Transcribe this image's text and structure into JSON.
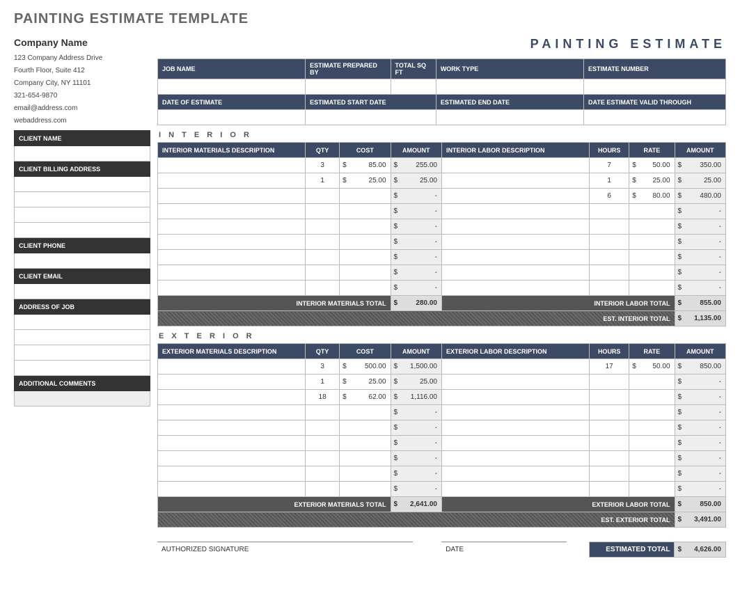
{
  "doc_title": "PAINTING ESTIMATE TEMPLATE",
  "estimate_heading": "PAINTING  ESTIMATE",
  "company": {
    "name": "Company Name",
    "addr1": "123 Company Address Drive",
    "addr2": "Fourth Floor, Suite 412",
    "addr3": "Company City, NY  11101",
    "phone": "321-654-9870",
    "email": "email@address.com",
    "web": "webaddress.com"
  },
  "job_header": {
    "labels": {
      "job_name": "JOB NAME",
      "prepared_by": "ESTIMATE PREPARED BY",
      "total_sqft": "TOTAL SQ FT",
      "work_type": "WORK TYPE",
      "estimate_number": "ESTIMATE NUMBER",
      "date_of_estimate": "DATE OF ESTIMATE",
      "est_start": "ESTIMATED START DATE",
      "est_end": "ESTIMATED END DATE",
      "valid_through": "DATE ESTIMATE VALID THROUGH"
    }
  },
  "client_labels": {
    "name": "CLIENT NAME",
    "billing": "CLIENT BILLING ADDRESS",
    "phone": "CLIENT PHONE",
    "email": "CLIENT EMAIL",
    "job_addr": "ADDRESS OF JOB",
    "comments": "ADDITIONAL COMMENTS"
  },
  "interior": {
    "title": "I N T E R I O R",
    "mat_headers": {
      "desc": "INTERIOR MATERIALS DESCRIPTION",
      "qty": "QTY",
      "cost": "COST",
      "amount": "AMOUNT"
    },
    "lab_headers": {
      "desc": "INTERIOR LABOR DESCRIPTION",
      "hours": "HOURS",
      "rate": "RATE",
      "amount": "AMOUNT"
    },
    "materials": [
      {
        "desc": "",
        "qty": "3",
        "cost": "85.00",
        "amount": "255.00"
      },
      {
        "desc": "",
        "qty": "1",
        "cost": "25.00",
        "amount": "25.00"
      },
      {
        "desc": "",
        "qty": "",
        "cost": "",
        "amount": "-"
      },
      {
        "desc": "",
        "qty": "",
        "cost": "",
        "amount": "-"
      },
      {
        "desc": "",
        "qty": "",
        "cost": "",
        "amount": "-"
      },
      {
        "desc": "",
        "qty": "",
        "cost": "",
        "amount": "-"
      },
      {
        "desc": "",
        "qty": "",
        "cost": "",
        "amount": "-"
      },
      {
        "desc": "",
        "qty": "",
        "cost": "",
        "amount": "-"
      },
      {
        "desc": "",
        "qty": "",
        "cost": "",
        "amount": "-"
      }
    ],
    "labor": [
      {
        "desc": "",
        "hours": "7",
        "rate": "50.00",
        "amount": "350.00"
      },
      {
        "desc": "",
        "hours": "1",
        "rate": "25.00",
        "amount": "25.00"
      },
      {
        "desc": "",
        "hours": "6",
        "rate": "80.00",
        "amount": "480.00"
      },
      {
        "desc": "",
        "hours": "",
        "rate": "",
        "amount": "-"
      },
      {
        "desc": "",
        "hours": "",
        "rate": "",
        "amount": "-"
      },
      {
        "desc": "",
        "hours": "",
        "rate": "",
        "amount": "-"
      },
      {
        "desc": "",
        "hours": "",
        "rate": "",
        "amount": "-"
      },
      {
        "desc": "",
        "hours": "",
        "rate": "",
        "amount": "-"
      },
      {
        "desc": "",
        "hours": "",
        "rate": "",
        "amount": "-"
      }
    ],
    "mat_total_label": "INTERIOR MATERIALS TOTAL",
    "mat_total": "280.00",
    "lab_total_label": "INTERIOR LABOR TOTAL",
    "lab_total": "855.00",
    "est_total_label": "EST. INTERIOR  TOTAL",
    "est_total": "1,135.00"
  },
  "exterior": {
    "title": "E X T E R I O R",
    "mat_headers": {
      "desc": "EXTERIOR MATERIALS DESCRIPTION",
      "qty": "QTY",
      "cost": "COST",
      "amount": "AMOUNT"
    },
    "lab_headers": {
      "desc": "EXTERIOR LABOR DESCRIPTION",
      "hours": "HOURS",
      "rate": "RATE",
      "amount": "AMOUNT"
    },
    "materials": [
      {
        "desc": "",
        "qty": "3",
        "cost": "500.00",
        "amount": "1,500.00"
      },
      {
        "desc": "",
        "qty": "1",
        "cost": "25.00",
        "amount": "25.00"
      },
      {
        "desc": "",
        "qty": "18",
        "cost": "62.00",
        "amount": "1,116.00"
      },
      {
        "desc": "",
        "qty": "",
        "cost": "",
        "amount": "-"
      },
      {
        "desc": "",
        "qty": "",
        "cost": "",
        "amount": "-"
      },
      {
        "desc": "",
        "qty": "",
        "cost": "",
        "amount": "-"
      },
      {
        "desc": "",
        "qty": "",
        "cost": "",
        "amount": "-"
      },
      {
        "desc": "",
        "qty": "",
        "cost": "",
        "amount": "-"
      },
      {
        "desc": "",
        "qty": "",
        "cost": "",
        "amount": "-"
      }
    ],
    "labor": [
      {
        "desc": "",
        "hours": "17",
        "rate": "50.00",
        "amount": "850.00"
      },
      {
        "desc": "",
        "hours": "",
        "rate": "",
        "amount": "-"
      },
      {
        "desc": "",
        "hours": "",
        "rate": "",
        "amount": "-"
      },
      {
        "desc": "",
        "hours": "",
        "rate": "",
        "amount": "-"
      },
      {
        "desc": "",
        "hours": "",
        "rate": "",
        "amount": "-"
      },
      {
        "desc": "",
        "hours": "",
        "rate": "",
        "amount": "-"
      },
      {
        "desc": "",
        "hours": "",
        "rate": "",
        "amount": "-"
      },
      {
        "desc": "",
        "hours": "",
        "rate": "",
        "amount": "-"
      },
      {
        "desc": "",
        "hours": "",
        "rate": "",
        "amount": "-"
      }
    ],
    "mat_total_label": "EXTERIOR MATERIALS TOTAL",
    "mat_total": "2,641.00",
    "lab_total_label": "EXTERIOR LABOR TOTAL",
    "lab_total": "850.00",
    "est_total_label": "EST. EXTERIOR  TOTAL",
    "est_total": "3,491.00"
  },
  "footer": {
    "signature_label": "AUTHORIZED SIGNATURE",
    "date_label": "DATE",
    "est_total_label": "ESTIMATED TOTAL",
    "est_total": "4,626.00"
  },
  "currency": "$"
}
